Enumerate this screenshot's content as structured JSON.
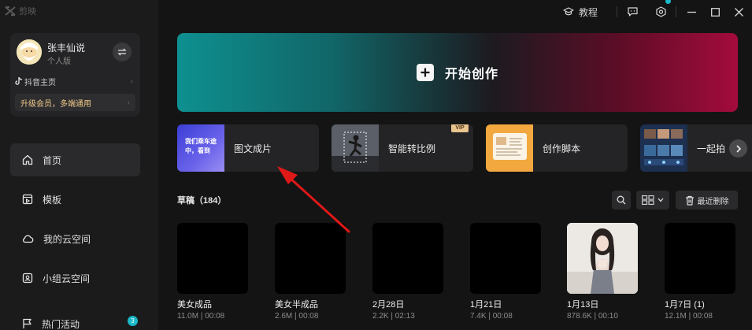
{
  "app": {
    "brand": "剪映",
    "accent": "#19b9c8"
  },
  "titlebar": {
    "tutorial_label": "教程",
    "icons": [
      "tutorial-icon",
      "feedback-icon",
      "settings-icon",
      "minimize-icon",
      "maximize-icon",
      "close-icon"
    ]
  },
  "user": {
    "name": "张丰仙说",
    "plan": "个人版",
    "douyin_label": "抖音主页",
    "upgrade_label": "升级会员，多端通用"
  },
  "nav": [
    {
      "label": "首页",
      "icon": "home-icon",
      "active": true
    },
    {
      "label": "模板",
      "icon": "template-icon"
    },
    {
      "label": "我的云空间",
      "icon": "cloud-icon"
    },
    {
      "label": "小组云空间",
      "icon": "team-cloud-icon"
    },
    {
      "label": "热门活动",
      "icon": "flag-icon",
      "badge": "3"
    }
  ],
  "hero": {
    "label": "开始创作"
  },
  "features": [
    {
      "label": "图文成片",
      "thumb_text": "我们乘车途中，看到"
    },
    {
      "label": "智能转比例",
      "vip": "VIP"
    },
    {
      "label": "创作脚本"
    },
    {
      "label": "一起拍"
    }
  ],
  "drafts": {
    "title": "草稿",
    "count": "（184）",
    "recycle_label": "最近删除",
    "items": [
      {
        "name": "美女成品",
        "size": "11.0M",
        "duration": "00:08"
      },
      {
        "name": "美女半成品",
        "size": "2.6M",
        "duration": "00:08"
      },
      {
        "name": "2月28日",
        "size": "2.2K",
        "duration": "02:13"
      },
      {
        "name": "1月21日",
        "size": "7.4K",
        "duration": "00:08"
      },
      {
        "name": "1月13日",
        "size": "878.6K",
        "duration": "00:10"
      },
      {
        "name": "1月7日 (1)",
        "size": "12.1M",
        "duration": "00:08"
      }
    ]
  },
  "meta_separator": " | "
}
